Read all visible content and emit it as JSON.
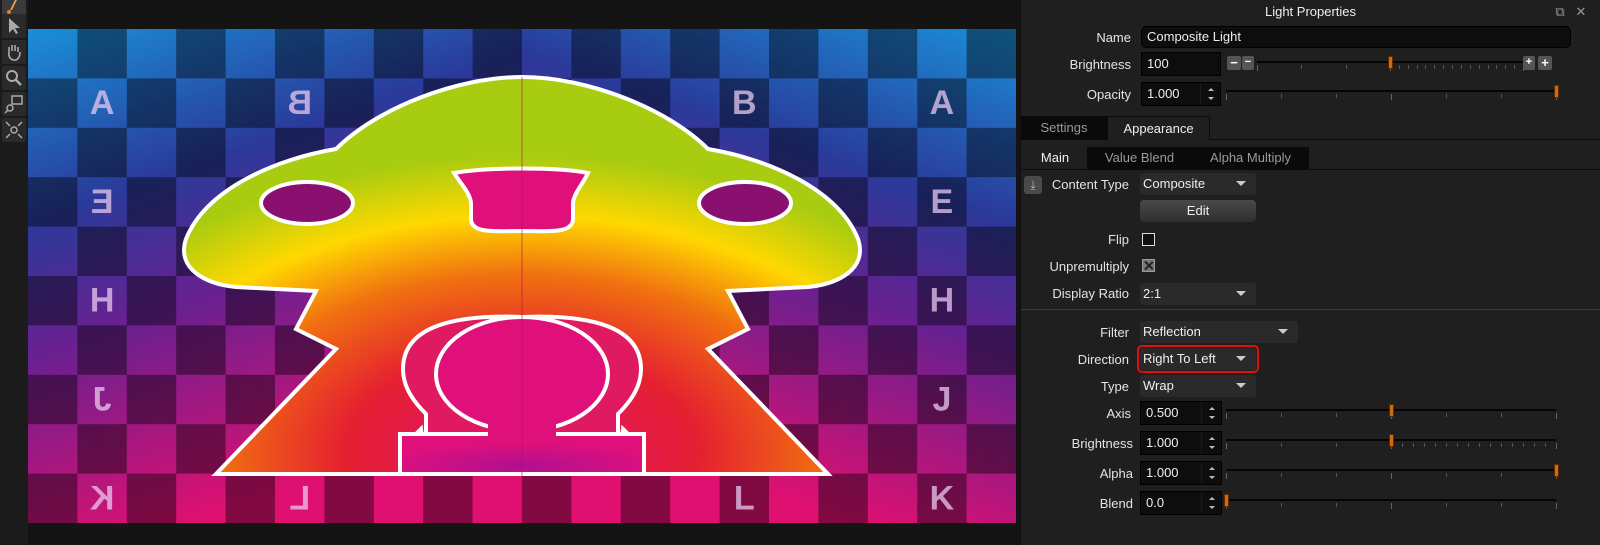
{
  "toolbar": {
    "tools": [
      {
        "name": "paint-tool"
      },
      {
        "name": "select-arrow-tool"
      },
      {
        "name": "pan-hand-tool"
      },
      {
        "name": "zoom-tool"
      },
      {
        "name": "zoom-region-tool"
      },
      {
        "name": "zoom-fit-tool"
      }
    ]
  },
  "viewport": {
    "grid_letters": [
      {
        "char": "A",
        "mirrored": false
      },
      {
        "char": "B",
        "mirrored": true
      },
      {
        "char": "B",
        "mirrored": false
      },
      {
        "char": "A",
        "mirrored": false
      },
      {
        "char": "E",
        "mirrored": true
      },
      {
        "char": "E",
        "mirrored": false
      },
      {
        "char": "H",
        "mirrored": false
      },
      {
        "char": "H",
        "mirrored": false
      },
      {
        "char": "J",
        "mirrored": true
      },
      {
        "char": "J",
        "mirrored": false
      },
      {
        "char": "K",
        "mirrored": true
      },
      {
        "char": "L",
        "mirrored": true
      },
      {
        "char": "L",
        "mirrored": false
      },
      {
        "char": "K",
        "mirrored": false
      }
    ]
  },
  "panel": {
    "title": "Light Properties",
    "name_label": "Name",
    "name_value": "Composite Light",
    "brightness_label": "Brightness",
    "brightness_value": "100",
    "brightness_slider": 0.5,
    "opacity_label": "Opacity",
    "opacity_value": "1.000",
    "opacity_slider": 1.0,
    "tabs": [
      {
        "label": "Settings",
        "active": false
      },
      {
        "label": "Appearance",
        "active": true
      }
    ],
    "subtabs": [
      {
        "label": "Main",
        "active": true
      },
      {
        "label": "Value Blend",
        "active": false
      },
      {
        "label": "Alpha Multiply",
        "active": false
      }
    ],
    "content_type_label": "Content Type",
    "content_type_value": "Composite",
    "edit_label": "Edit",
    "flip_label": "Flip",
    "flip_checked": false,
    "unpremultiply_label": "Unpremultiply",
    "unpremultiply_checked": true,
    "display_ratio_label": "Display Ratio",
    "display_ratio_value": "2:1",
    "filter_label": "Filter",
    "filter_value": "Reflection",
    "direction_label": "Direction",
    "direction_value": "Right To Left",
    "type_label": "Type",
    "type_value": "Wrap",
    "axis_label": "Axis",
    "axis_value": "0.500",
    "axis_slider": 0.5,
    "fbrightness_label": "Brightness",
    "fbrightness_value": "1.000",
    "fbrightness_slider": 0.5,
    "alpha_label": "Alpha",
    "alpha_value": "1.000",
    "alpha_slider": 1.0,
    "blend_label": "Blend",
    "blend_value": "0.0",
    "blend_slider": 0.0
  },
  "colors": {
    "accent_handle": "#d46a10",
    "highlight_outline": "#e01010"
  }
}
